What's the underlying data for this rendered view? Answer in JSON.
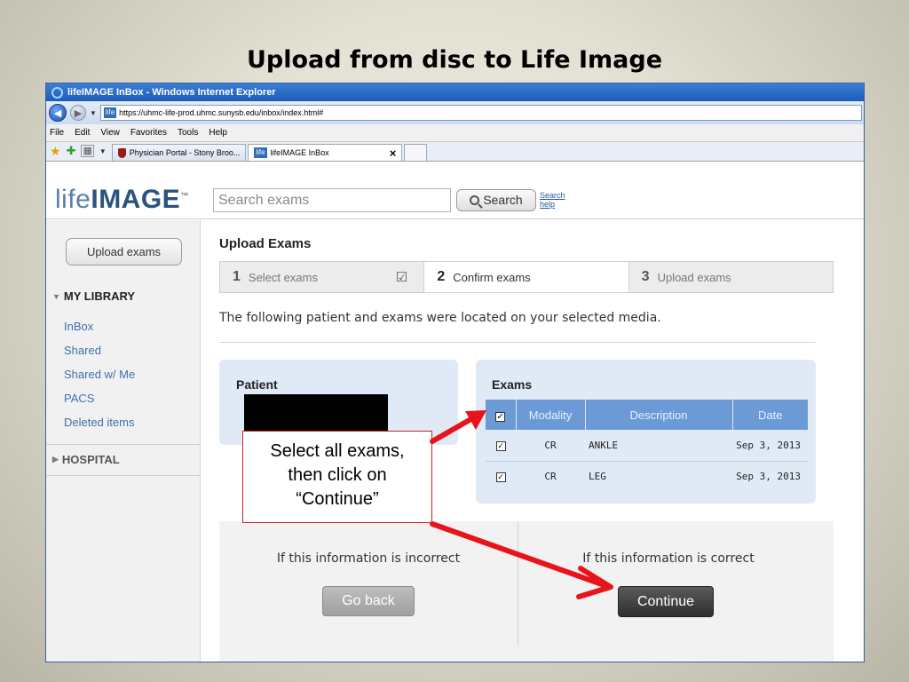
{
  "slide": {
    "title": "Upload from disc to Life Image"
  },
  "window": {
    "title": "lifeIMAGE InBox - Windows Internet Explorer",
    "url": "https://uhmc-life-prod.uhmc.sunysb.edu/inbox/index.html#",
    "site_badge": "life",
    "menu": [
      "File",
      "Edit",
      "View",
      "Favorites",
      "Tools",
      "Help"
    ],
    "tabs": [
      {
        "label": "Physician Portal - Stony Broo..."
      },
      {
        "label": "lifeIMAGE InBox",
        "close": "×"
      }
    ]
  },
  "header": {
    "logo_light": "life",
    "logo_bold": "IMAGE",
    "logo_tm": "™",
    "search_placeholder": "Search exams",
    "search_button": "Search",
    "search_help_1": "Search",
    "search_help_2": "help"
  },
  "sidebar": {
    "upload_button": "Upload exams",
    "my_library": "MY LIBRARY",
    "items": [
      "InBox",
      "Shared",
      "Shared w/ Me",
      "PACS",
      "Deleted items"
    ],
    "hospital": "HOSPITAL"
  },
  "main": {
    "heading": "Upload Exams",
    "steps": [
      {
        "num": "1",
        "label": "Select exams",
        "done": true
      },
      {
        "num": "2",
        "label": "Confirm exams",
        "done": false
      },
      {
        "num": "3",
        "label": "Upload exams",
        "done": false
      }
    ],
    "intro": "The following patient and exams were located on your selected media.",
    "patient_label": "Patient",
    "exams_label": "Exams",
    "columns": [
      "Modality",
      "Description",
      "Date"
    ],
    "exams": [
      {
        "modality": "CR",
        "description": "ANKLE",
        "date": "Sep 3, 2013",
        "checked": true
      },
      {
        "modality": "CR",
        "description": "LEG",
        "date": "Sep 3, 2013",
        "checked": true
      }
    ],
    "incorrect_text": "If this information is incorrect",
    "correct_text": "If this information is correct",
    "go_back": "Go back",
    "continue": "Continue"
  },
  "callout": {
    "line1": "Select all exams,",
    "line2": "then click on",
    "line3": "“Continue”"
  },
  "colors": {
    "arrow": "#e8131b",
    "table_header": "#6b9ad6",
    "panel": "#e0eaf7"
  }
}
